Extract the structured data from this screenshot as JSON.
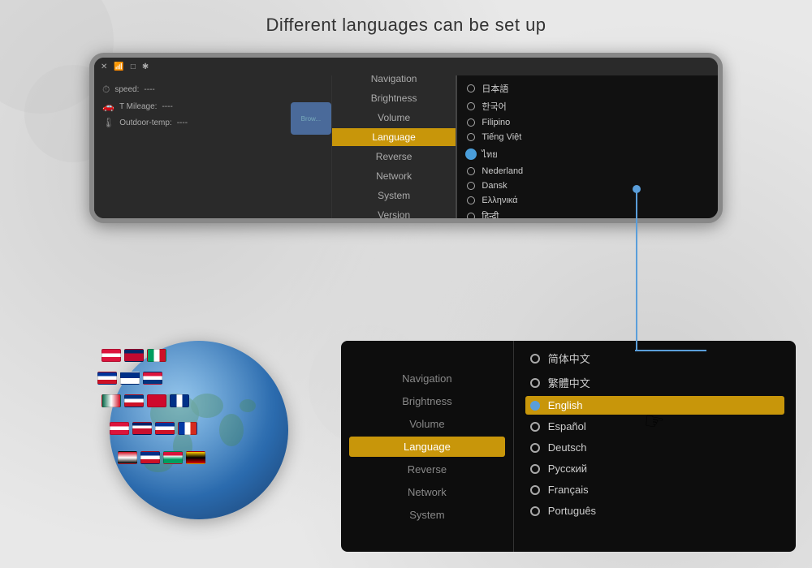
{
  "title": "Different languages can be set up",
  "device": {
    "statusIcons": [
      "✕",
      "📶",
      "□",
      "✱",
      "◻"
    ],
    "infoRows": [
      {
        "icon": "⏱",
        "label": "speed:",
        "value": "----"
      },
      {
        "icon": "🚗",
        "label": "T Mileage:",
        "value": "----"
      },
      {
        "icon": "🌡",
        "label": "Outdoor-temp:",
        "value": "----"
      }
    ],
    "browserLabel": "Brow...",
    "menuItems": [
      {
        "label": "Navigation",
        "active": false
      },
      {
        "label": "Brightness",
        "active": false
      },
      {
        "label": "Volume",
        "active": false
      },
      {
        "label": "Language",
        "active": true
      },
      {
        "label": "Reverse",
        "active": false
      },
      {
        "label": "Network",
        "active": false
      },
      {
        "label": "System",
        "active": false
      },
      {
        "label": "Version",
        "active": false
      }
    ],
    "languageList": [
      {
        "label": "日本語",
        "selected": false
      },
      {
        "label": "한국어",
        "selected": false
      },
      {
        "label": "Filipino",
        "selected": false
      },
      {
        "label": "Tiếng Việt",
        "selected": false
      },
      {
        "label": "ไทย",
        "selected": true
      },
      {
        "label": "Nederland",
        "selected": false
      },
      {
        "label": "Dansk",
        "selected": false
      },
      {
        "label": "Ελληνικά",
        "selected": false
      },
      {
        "label": "हिन्दी",
        "selected": false
      }
    ]
  },
  "bottomPanel": {
    "menuItems": [
      {
        "label": "Navigation",
        "active": false
      },
      {
        "label": "Brightness",
        "active": false
      },
      {
        "label": "Volume",
        "active": false
      },
      {
        "label": "Language",
        "active": true
      },
      {
        "label": "Reverse",
        "active": false
      },
      {
        "label": "Network",
        "active": false
      },
      {
        "label": "System",
        "active": false
      }
    ],
    "languageList": [
      {
        "label": "简体中文",
        "selected": false,
        "highlighted": false
      },
      {
        "label": "繁體中文",
        "selected": false,
        "highlighted": false
      },
      {
        "label": "English",
        "selected": true,
        "highlighted": true
      },
      {
        "label": "Español",
        "selected": false,
        "highlighted": false
      },
      {
        "label": "Deutsch",
        "selected": false,
        "highlighted": false
      },
      {
        "label": "Русский",
        "selected": false,
        "highlighted": false
      },
      {
        "label": "Français",
        "selected": false,
        "highlighted": false
      },
      {
        "label": "Português",
        "selected": false,
        "highlighted": false
      }
    ]
  },
  "flags": {
    "colors": [
      {
        "bg": "#bf0a30",
        "stripe": "#fff"
      },
      {
        "bg": "#003087",
        "stripe": "#fff"
      },
      {
        "bg": "#009e60",
        "stripe": "#fff"
      },
      {
        "bg": "#ce1126",
        "stripe": "#fff"
      },
      {
        "bg": "#003399",
        "stripe": "#fff"
      },
      {
        "bg": "#dc143c",
        "stripe": "#fff"
      },
      {
        "bg": "#006847",
        "stripe": "#fff"
      },
      {
        "bg": "#0033a0",
        "stripe": "#fff"
      },
      {
        "bg": "#ff0000",
        "stripe": "#fff"
      },
      {
        "bg": "#003580",
        "stripe": "#fc0"
      },
      {
        "bg": "#d52b1e",
        "stripe": "#fff"
      },
      {
        "bg": "#003087",
        "stripe": "#fff"
      }
    ]
  }
}
